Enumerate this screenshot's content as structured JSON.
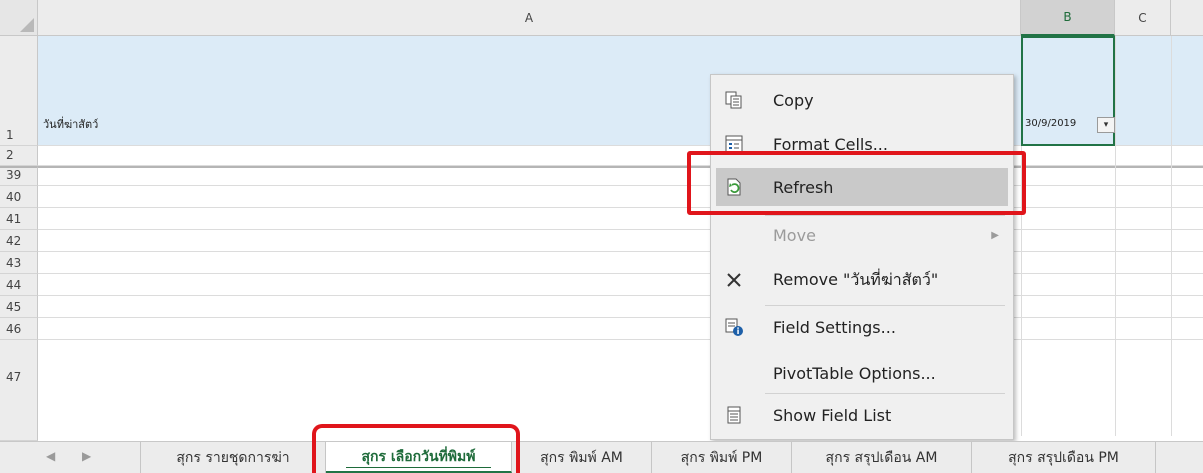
{
  "sheet": {
    "columns": [
      "A",
      "B",
      "C"
    ],
    "rows": [
      "1",
      "2",
      "39",
      "40",
      "41",
      "42",
      "43",
      "44",
      "45",
      "46",
      "47"
    ],
    "cell_A1": "วันที่ฆ่าสัตว์",
    "cell_B1": "30/9/2019"
  },
  "context_menu": {
    "items": [
      {
        "label": "Copy",
        "icon": "copy-icon"
      },
      {
        "label": "Format Cells...",
        "icon": "format-cells-icon"
      },
      {
        "label": "Refresh",
        "icon": "refresh-icon"
      },
      {
        "label": "Move",
        "icon": "",
        "disabled": true
      },
      {
        "label": "Remove \"วันที่ฆ่าสัตว์\"",
        "icon": "remove-x-icon"
      },
      {
        "label": "Field Settings...",
        "icon": "field-settings-icon"
      },
      {
        "label": "PivotTable Options...",
        "icon": ""
      },
      {
        "label": "Show Field List",
        "icon": "field-list-icon"
      }
    ]
  },
  "tabs": [
    {
      "label": "สุกร รายชุดการฆ่า"
    },
    {
      "label": "สุกร เลือกวันที่พิมพ์",
      "active": true
    },
    {
      "label": "สุกร พิมพ์ AM"
    },
    {
      "label": "สุกร พิมพ์ PM"
    },
    {
      "label": "สุกร สรุปเดือน AM"
    },
    {
      "label": "สุกร สรุปเดือน PM"
    }
  ],
  "colors": {
    "excel_green": "#217346",
    "highlight_red": "#e0151b",
    "selection_blue": "#dcebf7"
  }
}
